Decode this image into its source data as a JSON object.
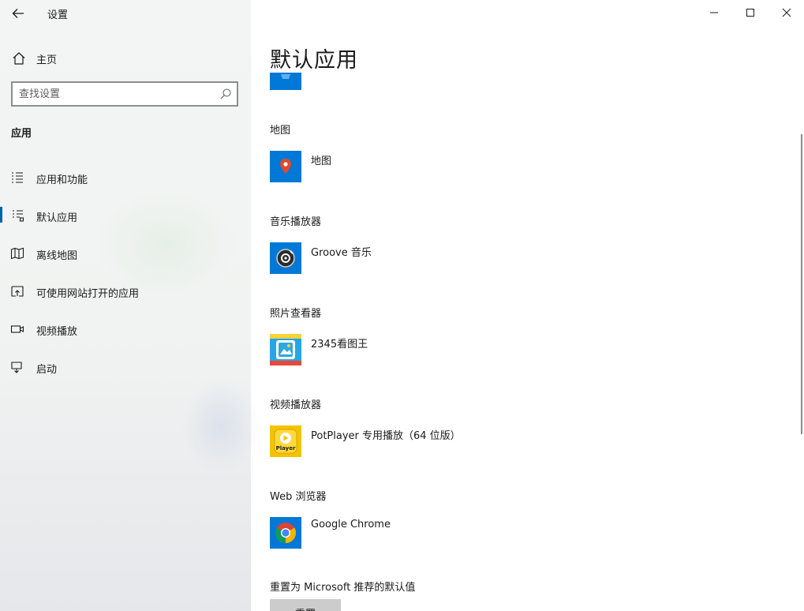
{
  "window": {
    "title": "设置",
    "back_label": "",
    "icons": {
      "back": "back-arrow-icon",
      "minimize": "minimize-icon",
      "maximize": "maximize-icon",
      "close": "close-icon"
    }
  },
  "sidebar": {
    "home_label": "主页",
    "search": {
      "placeholder": "查找设置",
      "value": ""
    },
    "section_label": "应用",
    "selected_index": 1,
    "items": [
      {
        "label": "应用和功能",
        "icon": "apps-list-icon"
      },
      {
        "label": "默认应用",
        "icon": "default-apps-icon"
      },
      {
        "label": "离线地图",
        "icon": "offline-map-icon"
      },
      {
        "label": "可使用网站打开的应用",
        "icon": "open-web-icon"
      },
      {
        "label": "视频播放",
        "icon": "video-icon"
      },
      {
        "label": "启动",
        "icon": "startup-icon"
      }
    ]
  },
  "main": {
    "title": "默认应用",
    "categories": [
      {
        "label": "地图",
        "app": "地图",
        "icon": "maps-pin-icon"
      },
      {
        "label": "音乐播放器",
        "app": "Groove 音乐",
        "icon": "groove-music-icon"
      },
      {
        "label": "照片查看器",
        "app": "2345看图王",
        "icon": "image-viewer-icon"
      },
      {
        "label": "视频播放器",
        "app": "PotPlayer 专用播放（64 位版）",
        "icon": "potplayer-icon",
        "icon_text": "Player"
      },
      {
        "label": "Web 浏览器",
        "app": "Google Chrome",
        "icon": "chrome-icon"
      }
    ],
    "reset_label": "重置为 Microsoft 推荐的默认值",
    "reset_button": "重置"
  },
  "colors": {
    "accent": "#0078d7",
    "selection_bar": "#0063b1",
    "maps_pin": "#e24a2c",
    "potplayer_bg": "#f4c300",
    "reset_button_bg": "#cccccc"
  }
}
